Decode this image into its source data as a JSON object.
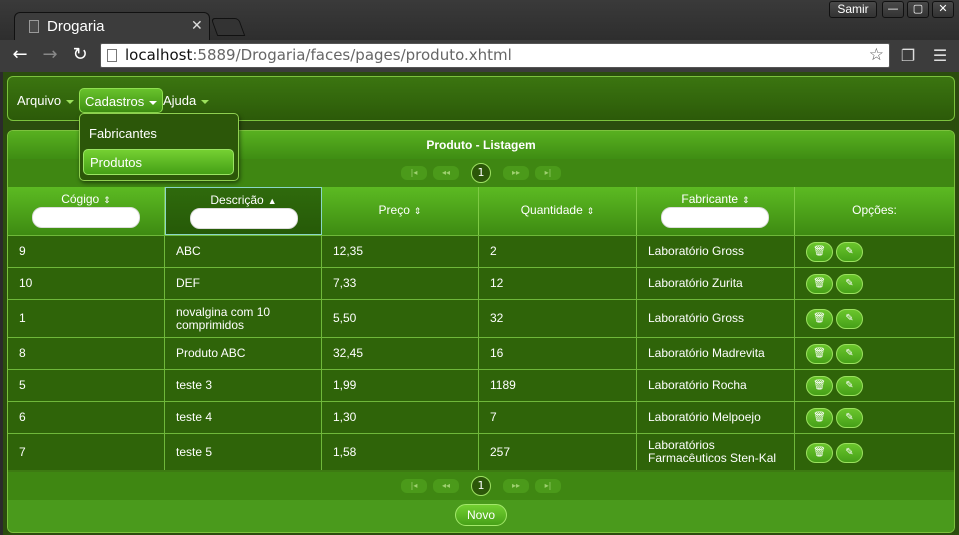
{
  "browser": {
    "tab_title": "Drogaria",
    "tab_close": "✕",
    "user": "Samir",
    "url_host": "localhost",
    "url_path": ":5889/Drogaria/faces/pages/produto.xhtml",
    "window_buttons": [
      "—",
      "▢",
      "✕"
    ]
  },
  "menu": {
    "items": [
      {
        "label": "Arquivo"
      },
      {
        "label": "Cadastros"
      },
      {
        "label": "Ajuda"
      }
    ],
    "dropdown": [
      {
        "label": "Fabricantes"
      },
      {
        "label": "Produtos"
      }
    ]
  },
  "panel": {
    "title": "Produto - Listagem",
    "page": "1",
    "new_button": "Novo"
  },
  "table": {
    "columns": [
      {
        "label": "Cógigo",
        "sort": "⇕"
      },
      {
        "label": "Descrição",
        "sort": "▲"
      },
      {
        "label": "Preço",
        "sort": "⇕"
      },
      {
        "label": "Quantidade",
        "sort": "⇕"
      },
      {
        "label": "Fabricante",
        "sort": "⇕"
      },
      {
        "label": "Opções:"
      }
    ],
    "rows": [
      {
        "codigo": "9",
        "descricao": "ABC",
        "preco": "12,35",
        "quantidade": "2",
        "fabricante": "Laboratório Gross"
      },
      {
        "codigo": "10",
        "descricao": "DEF",
        "preco": "7,33",
        "quantidade": "12",
        "fabricante": "Laboratório Zurita"
      },
      {
        "codigo": "1",
        "descricao": "novalgina com 10 comprimidos",
        "preco": "5,50",
        "quantidade": "32",
        "fabricante": "Laboratório Gross"
      },
      {
        "codigo": "8",
        "descricao": "Produto ABC",
        "preco": "32,45",
        "quantidade": "16",
        "fabricante": "Laboratório Madrevita"
      },
      {
        "codigo": "5",
        "descricao": "teste 3",
        "preco": "1,99",
        "quantidade": "1189",
        "fabricante": "Laboratório Rocha"
      },
      {
        "codigo": "6",
        "descricao": "teste 4",
        "preco": "1,30",
        "quantidade": "7",
        "fabricante": "Laboratório Melpoejo"
      },
      {
        "codigo": "7",
        "descricao": "teste 5",
        "preco": "1,58",
        "quantidade": "257",
        "fabricante": "Laboratórios Farmacêuticos Sten-Kal"
      }
    ]
  },
  "icons": {
    "delete": "trash-icon",
    "edit": "pencil-icon"
  }
}
